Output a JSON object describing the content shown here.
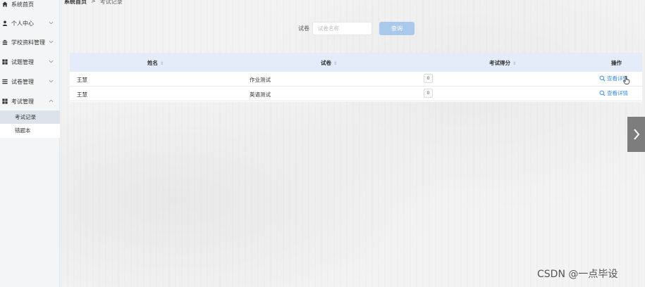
{
  "sidebar": {
    "items": [
      {
        "label": "系统首页",
        "icon": "home-icon"
      },
      {
        "label": "个人中心",
        "icon": "user-icon"
      },
      {
        "label": "学校资料管理",
        "icon": "bank-icon"
      },
      {
        "label": "试题管理",
        "icon": "grid-icon"
      },
      {
        "label": "试卷管理",
        "icon": "list-icon"
      },
      {
        "label": "考试管理",
        "icon": "grid-icon"
      }
    ],
    "sub_items": [
      {
        "label": "考试记录"
      },
      {
        "label": "错题本"
      }
    ]
  },
  "breadcrumb": {
    "home": "系统首页",
    "separator": ">",
    "current": "考试记录"
  },
  "search": {
    "label": "试卷",
    "placeholder": "试卷名称",
    "button_label": "查询"
  },
  "table": {
    "columns": [
      "姓名",
      "试卷",
      "考试得分",
      "操作"
    ],
    "rows": [
      {
        "name": "王慧",
        "paper": "作业测试",
        "score": "0",
        "action": "查看详情"
      },
      {
        "name": "王慧",
        "paper": "英语测试",
        "score": "0",
        "action": "查看详情"
      }
    ]
  },
  "watermark": "CSDN @一点毕设",
  "colors": {
    "accent": "#3b8be8",
    "button": "#a9c9ec",
    "header_bg": "#e3ecf8",
    "active_sub": "#dde3ea"
  }
}
